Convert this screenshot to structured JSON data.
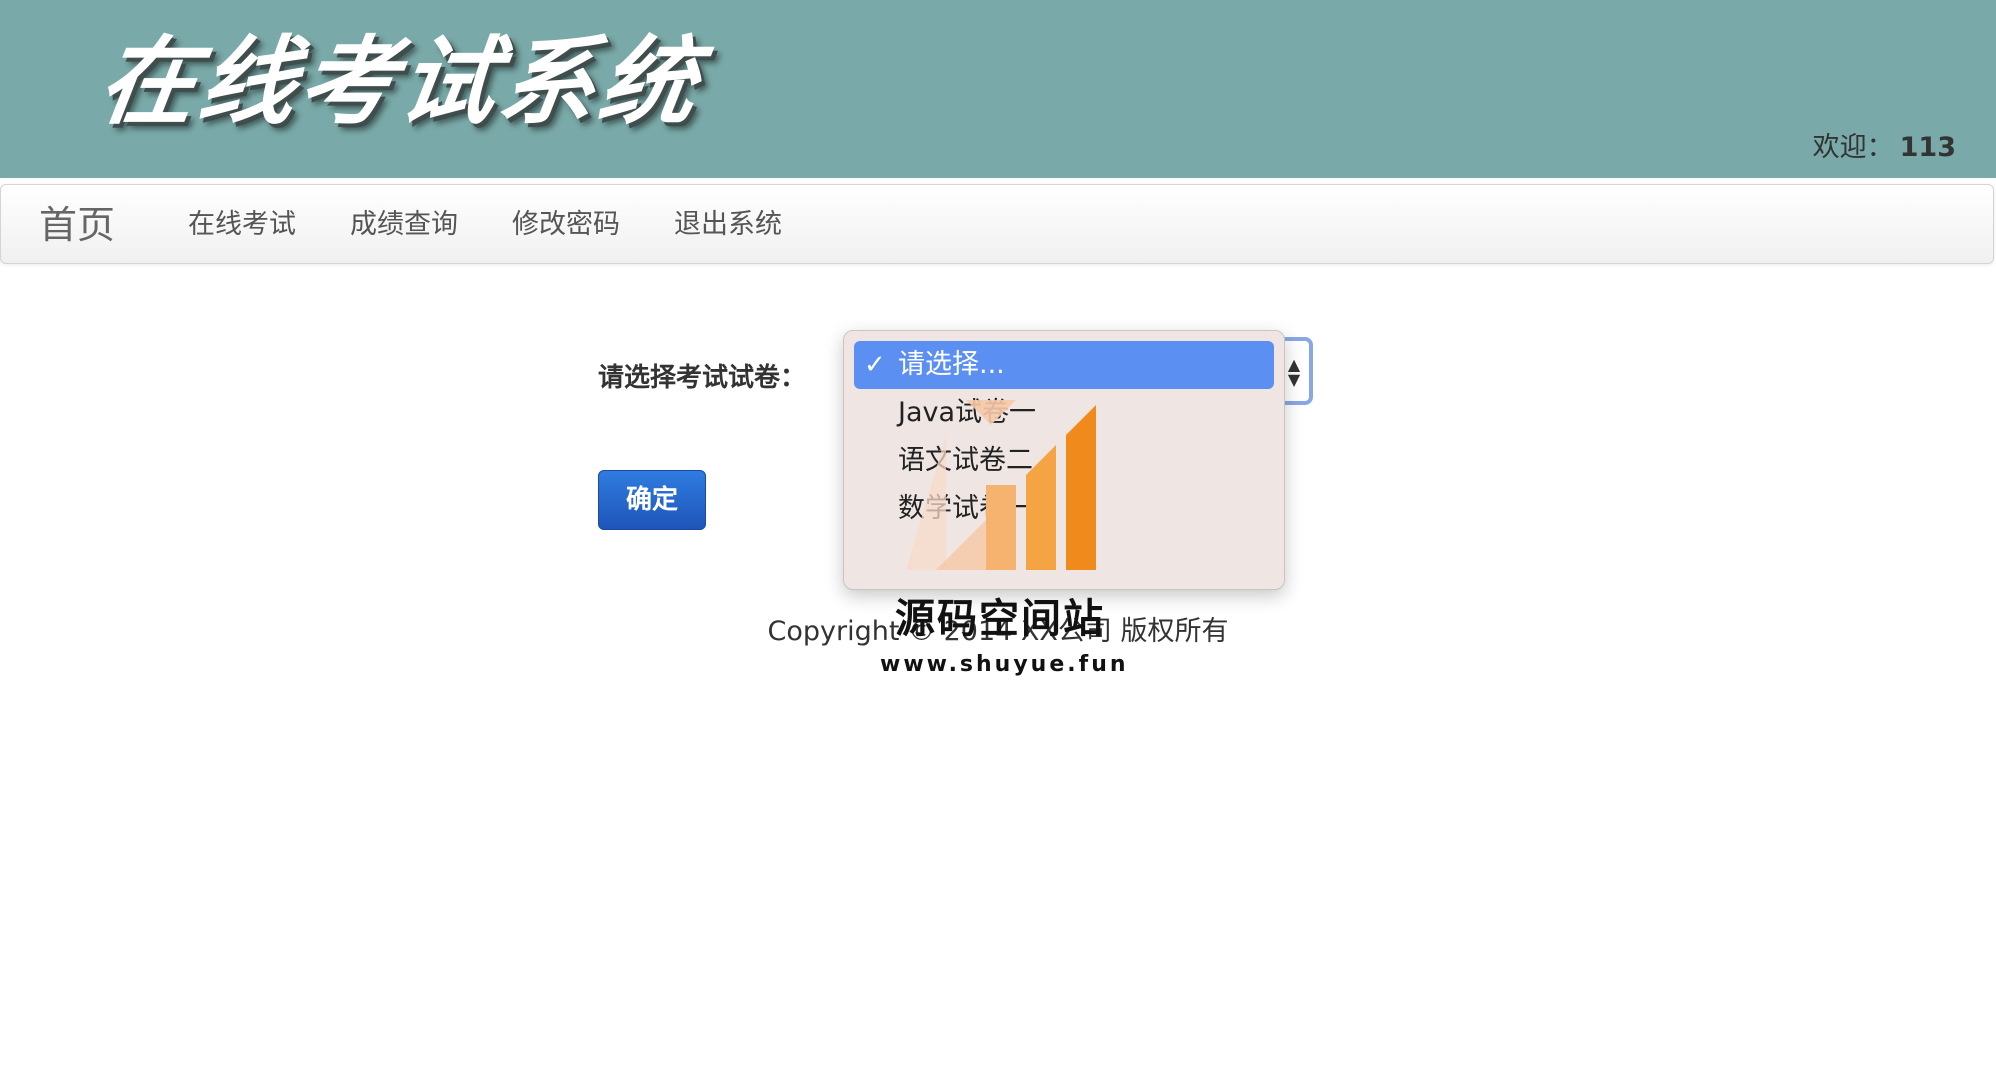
{
  "header": {
    "title": "在线考试系统",
    "welcome_label": "欢迎：",
    "username": "113"
  },
  "navbar": {
    "brand": "首页",
    "items": [
      {
        "label": "在线考试"
      },
      {
        "label": "成绩查询"
      },
      {
        "label": "修改密码"
      },
      {
        "label": "退出系统"
      }
    ]
  },
  "form": {
    "select_label": "请选择考试试卷：",
    "selected_value": "请选择...",
    "options": [
      {
        "label": "请选择...",
        "selected": true
      },
      {
        "label": "Java试卷一",
        "selected": false
      },
      {
        "label": "语文试卷二",
        "selected": false
      },
      {
        "label": "数学试卷一",
        "selected": false
      },
      {
        "label": "",
        "selected": false
      }
    ],
    "confirm_label": "确定"
  },
  "footer": {
    "copyright": "Copyright © 2014 XX公司 版权所有"
  },
  "watermark": {
    "title": "源码空间站",
    "url": "www.shuyue.fun"
  },
  "colors": {
    "header_bg": "#79a9a8",
    "selected_option": "#5b8ff2",
    "confirm_button": "#2563c9",
    "watermark_orange": "#f08a1c"
  }
}
